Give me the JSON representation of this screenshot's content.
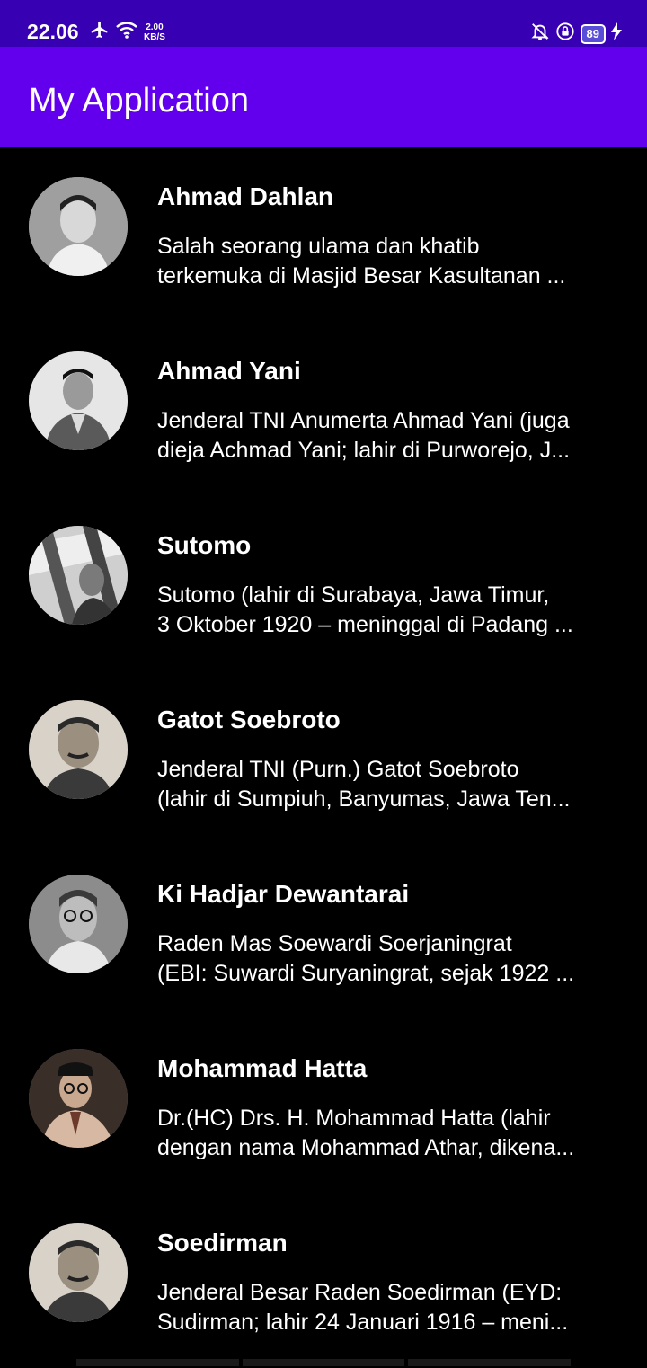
{
  "status_bar": {
    "time": "22.06",
    "net_speed_value": "2.00",
    "net_speed_unit": "KB/S",
    "battery": "89",
    "icons": [
      "airplane-icon",
      "wifi-icon",
      "bell-off-icon",
      "lock-rotation-icon",
      "battery-icon",
      "charging-icon"
    ]
  },
  "app_bar": {
    "title": "My Application",
    "color": "#6200ee",
    "status_color": "#3700b3"
  },
  "heroes": [
    {
      "name": "Ahmad Dahlan",
      "desc_line1": "Salah seorang ulama dan khatib",
      "desc_line2": "terkemuka di Masjid Besar Kasultanan ..."
    },
    {
      "name": "Ahmad Yani",
      "desc_line1": "Jenderal TNI Anumerta Ahmad Yani (juga",
      "desc_line2": "dieja Achmad Yani; lahir di Purworejo, J..."
    },
    {
      "name": "Sutomo",
      "desc_line1": "Sutomo (lahir di Surabaya, Jawa Timur,",
      "desc_line2": "3 Oktober 1920 – meninggal di Padang ..."
    },
    {
      "name": "Gatot Soebroto",
      "desc_line1": "Jenderal TNI (Purn.) Gatot Soebroto",
      "desc_line2": "(lahir di Sumpiuh, Banyumas, Jawa Ten..."
    },
    {
      "name": "Ki Hadjar Dewantarai",
      "desc_line1": "Raden Mas Soewardi Soerjaningrat",
      "desc_line2": "(EBI: Suwardi Suryaningrat, sejak 1922 ..."
    },
    {
      "name": "Mohammad Hatta",
      "desc_line1": "Dr.(HC) Drs. H. Mohammad Hatta (lahir",
      "desc_line2": "dengan nama Mohammad Athar, dikena..."
    },
    {
      "name": "Soedirman",
      "desc_line1": "Jenderal Besar Raden Soedirman (EYD:",
      "desc_line2": "Sudirman; lahir 24 Januari 1916 – meni..."
    }
  ]
}
